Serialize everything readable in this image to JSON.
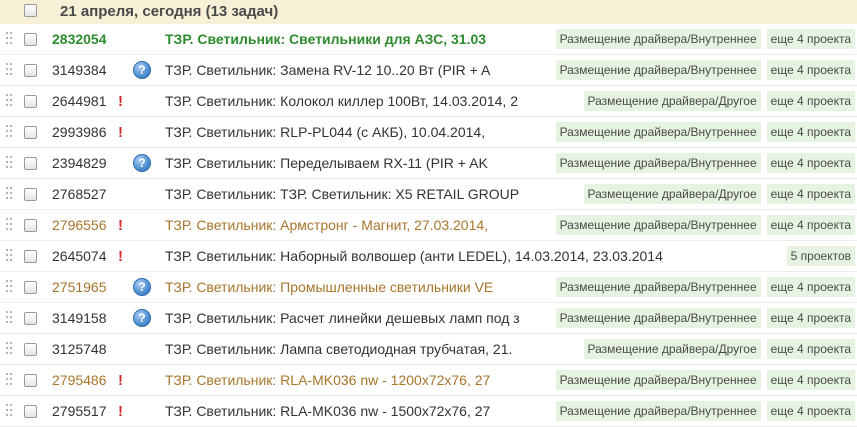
{
  "header": {
    "title": "21 апреля, сегодня (13 задач)"
  },
  "colors": {
    "green": "#2e8b2e",
    "brown": "#a8752a",
    "dark": "#333333",
    "tag_bg": "#e6f3e0",
    "header_bg": "#f5f0d6"
  },
  "tasks": [
    {
      "id": "2832054",
      "title": "ТЗР. Светильник: Светильники для АЗС, 31.03",
      "tag": "Размещение драйвера/Внутреннее",
      "extra": "еще 4 проекта",
      "icon": "none",
      "color": "green",
      "bold": true
    },
    {
      "id": "3149384",
      "title": "ТЗР. Светильник: Замена RV-12 10..20 Вт (PIR + A",
      "tag": "Размещение драйвера/Внутреннее",
      "extra": "еще 4 проекта",
      "icon": "help-icon",
      "color": "dark",
      "bold": false
    },
    {
      "id": "2644981",
      "title": "ТЗР. Светильник: Колокол киллер 100Вт, 14.03.2014, 2",
      "tag": "Размещение драйвера/Другое",
      "extra": "еще 4 проекта",
      "icon": "exclamation-icon",
      "color": "dark",
      "bold": false
    },
    {
      "id": "2993986",
      "title": "ТЗР. Светильник: RLP-PL044 (с АКБ), 10.04.2014, ",
      "tag": "Размещение драйвера/Внутреннее",
      "extra": "еще 4 проекта",
      "icon": "exclamation-icon",
      "color": "dark",
      "bold": false
    },
    {
      "id": "2394829",
      "title": "ТЗР. Светильник: Переделываем RX-11 (PIR + AK",
      "tag": "Размещение драйвера/Внутреннее",
      "extra": "еще 4 проекта",
      "icon": "help-icon",
      "color": "dark",
      "bold": false
    },
    {
      "id": "2768527",
      "title": "ТЗР. Светильник: ТЗР. Светильник: X5 RETAIL GROUP",
      "tag": "Размещение драйвера/Другое",
      "extra": "еще 4 проекта",
      "icon": "none",
      "color": "dark",
      "bold": false
    },
    {
      "id": "2796556",
      "title": "ТЗР. Светильник: Армстронг - Магнит, 27.03.2014, ",
      "tag": "Размещение драйвера/Внутреннее",
      "extra": "еще 4 проекта",
      "icon": "exclamation-icon",
      "color": "brown",
      "bold": false
    },
    {
      "id": "2645074",
      "title": "ТЗР. Светильник: Наборный волвошер (анти LEDEL), 14.03.2014, 23.03.2014",
      "tag": "",
      "extra": "5 проектов",
      "icon": "exclamation-icon",
      "color": "dark",
      "bold": false
    },
    {
      "id": "2751965",
      "title": "ТЗР. Светильник: Промышленные светильники VE",
      "tag": "Размещение драйвера/Внутреннее",
      "extra": "еще 4 проекта",
      "icon": "help-icon",
      "color": "brown",
      "bold": false
    },
    {
      "id": "3149158",
      "title": "ТЗР. Светильник: Расчет линейки дешевых ламп под з",
      "tag": "Размещение драйвера/Внутреннее",
      "extra": "еще 4 проекта",
      "icon": "help-icon",
      "color": "dark",
      "bold": false
    },
    {
      "id": "3125748",
      "title": "ТЗР. Светильник: Лампа светодиодная трубчатая, 21.",
      "tag": "Размещение драйвера/Другое",
      "extra": "еще 4 проекта",
      "icon": "none",
      "color": "dark",
      "bold": false
    },
    {
      "id": "2795486",
      "title": "ТЗР. Светильник: RLA-MK036 nw - 1200x72x76, 27",
      "tag": "Размещение драйвера/Внутреннее",
      "extra": "еще 4 проекта",
      "icon": "exclamation-icon",
      "color": "brown",
      "bold": false
    },
    {
      "id": "2795517",
      "title": "ТЗР. Светильник: RLA-MK036 nw - 1500x72x76, 27",
      "tag": "Размещение драйвера/Внутреннее",
      "extra": "еще 4 проекта",
      "icon": "exclamation-icon",
      "color": "dark",
      "bold": false
    }
  ]
}
